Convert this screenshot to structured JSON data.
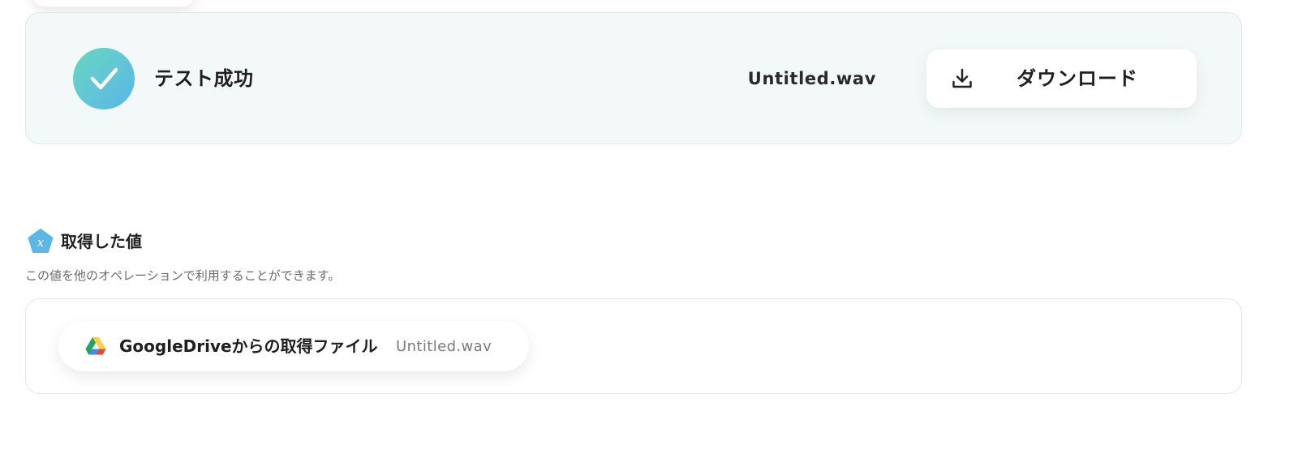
{
  "test_result": {
    "status_text": "テスト成功",
    "file_name": "Untitled.wav",
    "download_label": "ダウンロード",
    "icons": {
      "status": "check-icon",
      "download": "download-icon"
    },
    "colors": {
      "badge_gradient_start": "#68d7c0",
      "badge_gradient_end": "#5bb5ea",
      "panel_background": "#f3f8f8"
    }
  },
  "retrieved_values": {
    "title": "取得した値",
    "description": "この値を他のオペレーションで利用することができます。",
    "title_icon": "variable-icon",
    "items": [
      {
        "icon": "google-drive-icon",
        "label": "GoogleDriveからの取得ファイル",
        "value": "Untitled.wav"
      }
    ]
  }
}
